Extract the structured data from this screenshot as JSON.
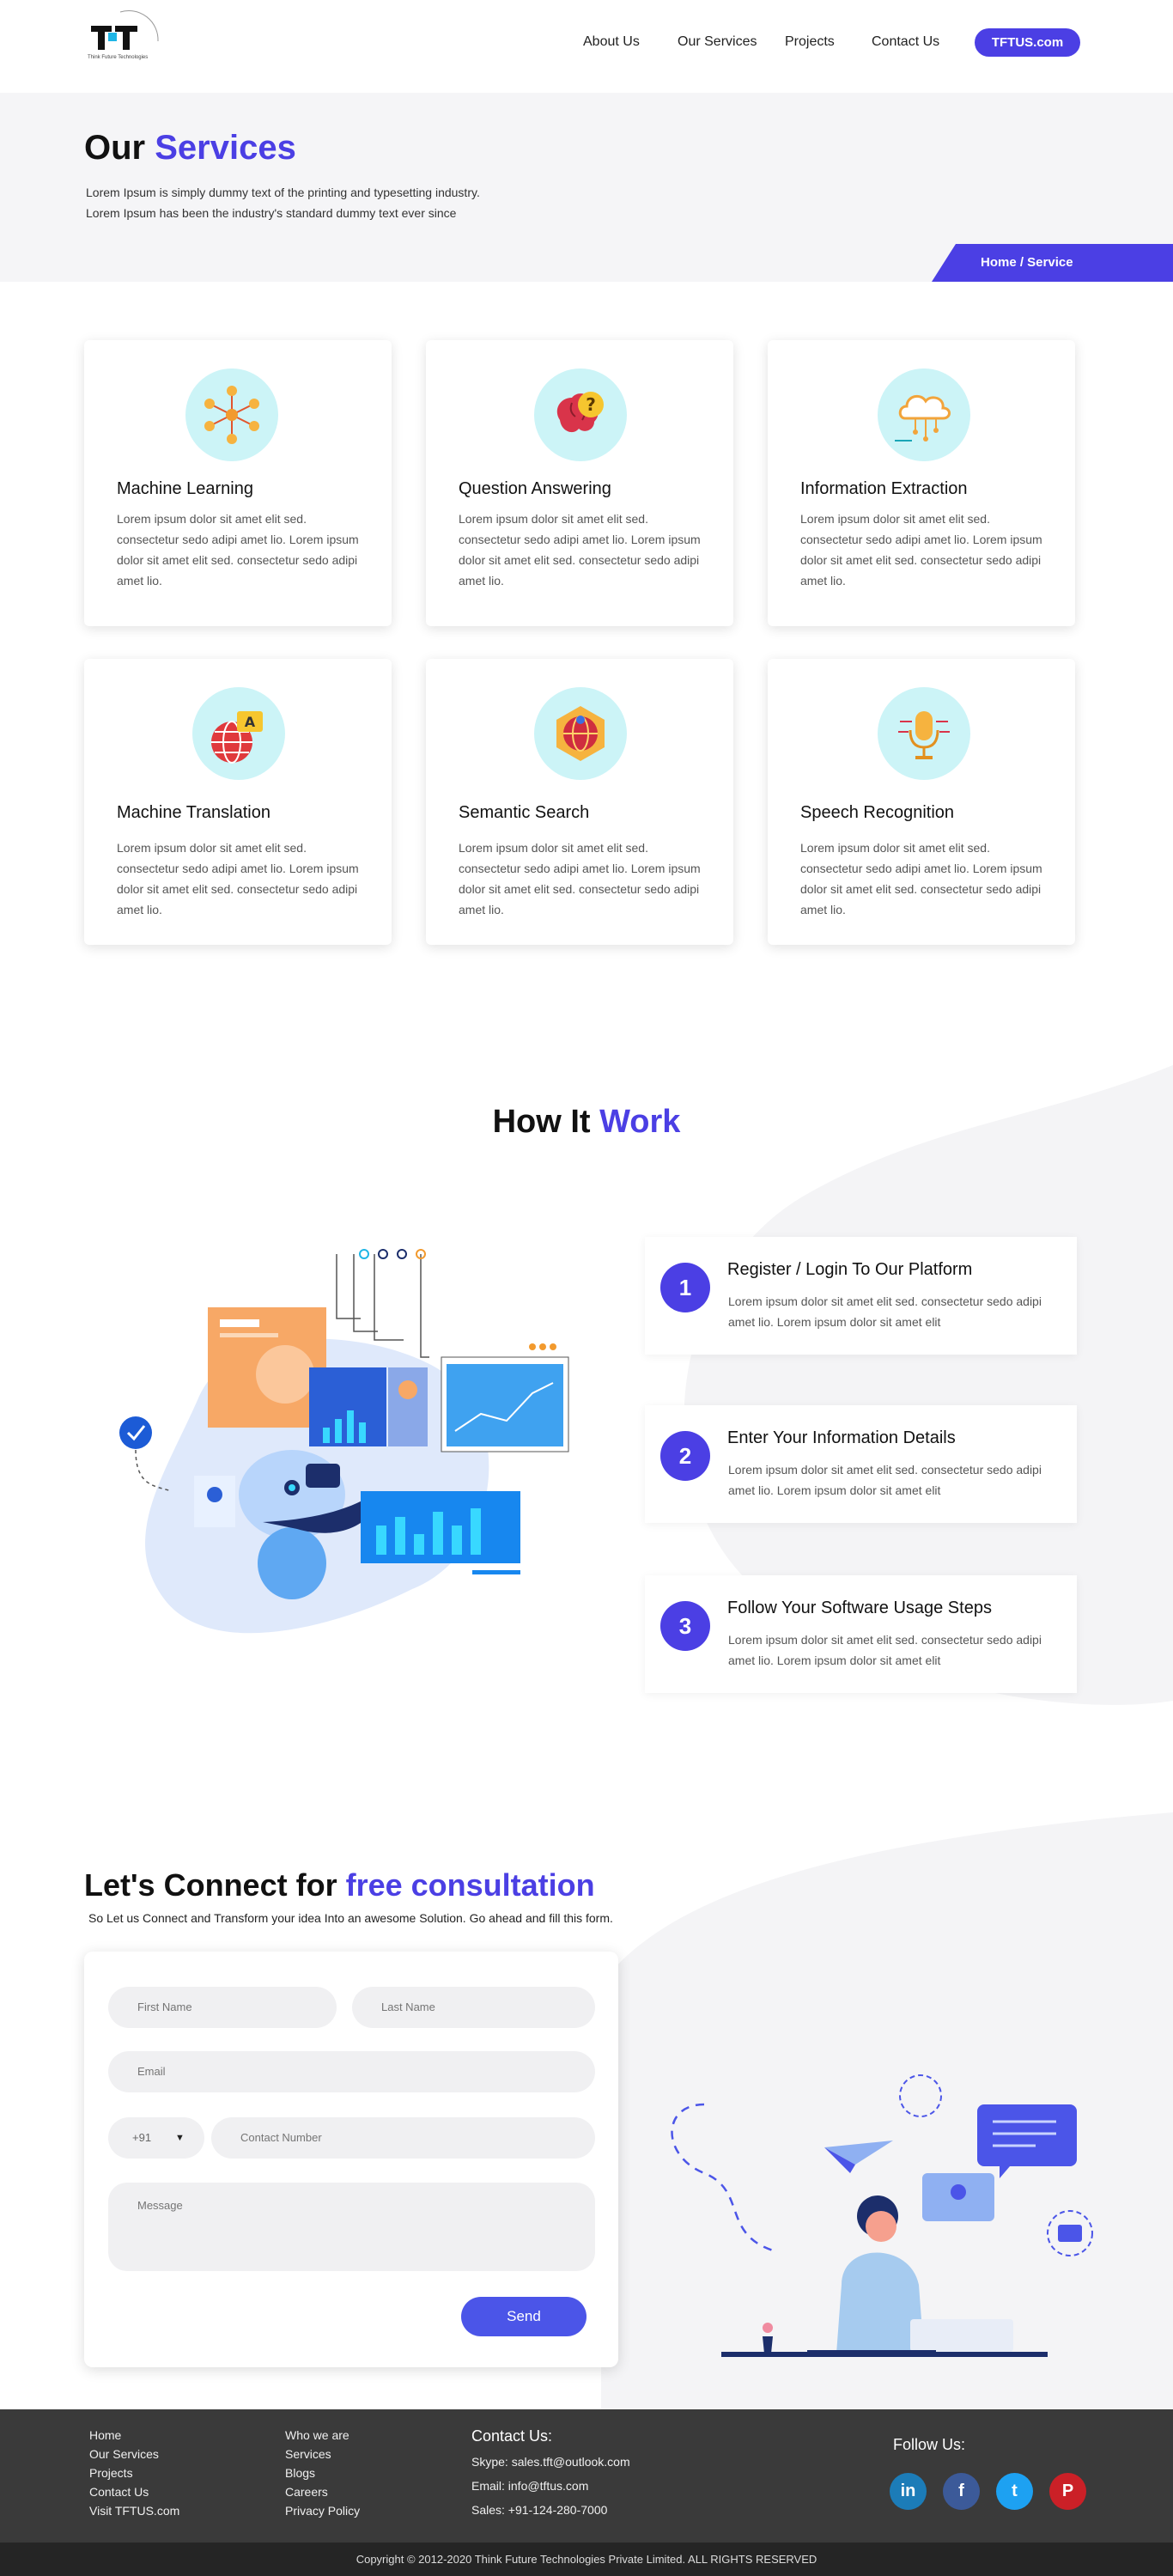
{
  "header": {
    "logo_text": "TFT",
    "logo_tagline": "Think Future Technologies",
    "nav": [
      "About Us",
      "Our Services",
      "Projects",
      "Contact Us"
    ],
    "cta": "TFTUS.com"
  },
  "hero": {
    "title_part1": "Our ",
    "title_part2": "Services",
    "desc_line1": "Lorem Ipsum is simply dummy text of the printing and typesetting industry.",
    "desc_line2": "Lorem Ipsum has been the industry's standard dummy text ever since",
    "breadcrumb": "Home / Service"
  },
  "services": [
    {
      "title": "Machine Learning",
      "icon": "network-icon",
      "desc": "Lorem ipsum dolor sit amet elit sed. consectetur sedo adipi amet lio. Lorem ipsum dolor sit amet elit sed. consectetur sedo adipi amet lio."
    },
    {
      "title": "Question Answering",
      "icon": "brain-question-icon",
      "desc": "Lorem ipsum dolor sit amet elit sed. consectetur sedo adipi amet lio. Lorem ipsum dolor sit amet elit sed. consectetur sedo adipi amet lio."
    },
    {
      "title": "Information Extraction",
      "icon": "cloud-data-icon",
      "desc": "Lorem ipsum dolor sit amet elit sed. consectetur sedo adipi amet lio. Lorem ipsum dolor sit amet elit sed. consectetur sedo adipi amet lio."
    },
    {
      "title": "Machine Translation",
      "icon": "globe-translate-icon",
      "desc": "Lorem ipsum dolor sit amet elit sed. consectetur sedo adipi amet lio. Lorem ipsum dolor sit amet elit sed. consectetur sedo adipi amet lio."
    },
    {
      "title": "Semantic Search",
      "icon": "globe-search-icon",
      "desc": "Lorem ipsum dolor sit amet elit sed. consectetur sedo adipi amet lio. Lorem ipsum dolor sit amet elit sed. consectetur sedo adipi amet lio."
    },
    {
      "title": "Speech Recognition",
      "icon": "microphone-icon",
      "desc": "Lorem ipsum dolor sit amet elit sed. consectetur sedo adipi amet lio. Lorem ipsum dolor sit amet elit sed. consectetur sedo adipi amet lio."
    }
  ],
  "how": {
    "title_part1": "How It ",
    "title_part2": "Work",
    "steps": [
      {
        "num": "1",
        "title": "Register / Login To Our Platform",
        "desc": "Lorem ipsum dolor sit amet elit sed. consectetur sedo adipi amet lio. Lorem ipsum dolor sit amet elit"
      },
      {
        "num": "2",
        "title": "Enter Your Information Details",
        "desc": "Lorem ipsum dolor sit amet elit sed. consectetur sedo adipi amet lio. Lorem ipsum dolor sit amet elit"
      },
      {
        "num": "3",
        "title": "Follow Your Software Usage Steps",
        "desc": "Lorem ipsum dolor sit amet elit sed. consectetur sedo adipi amet lio. Lorem ipsum dolor sit amet elit"
      }
    ]
  },
  "connect": {
    "title_part1": "Let's Connect for ",
    "title_part2": "free consultation",
    "subtitle": "So Let us Connect and Transform your idea Into an awesome Solution. Go ahead and fill this form.",
    "first_name": "First Name",
    "last_name": "Last Name",
    "email": "Email",
    "country_code": "+91",
    "contact_number": "Contact Number",
    "message": "Message",
    "send": "Send"
  },
  "footer": {
    "col1": [
      "Home",
      "Our Services",
      "Projects",
      "Contact Us",
      "Visit TFTUS.com"
    ],
    "col2": [
      "Who we are",
      "Services",
      "Blogs",
      "Careers",
      "Privacy Policy"
    ],
    "contact_title": "Contact Us:",
    "skype": "Skype: sales.tft@outlook.com",
    "email": "Email: info@tftus.com",
    "sales": "Sales: +91-124-280-7000",
    "follow_title": "Follow Us:",
    "social": [
      {
        "label": "in",
        "icon": "linkedin-icon",
        "color": "#1c7cb8"
      },
      {
        "label": "f",
        "icon": "facebook-icon",
        "color": "#3c5a99"
      },
      {
        "label": "t",
        "icon": "twitter-icon",
        "color": "#1da1f2"
      },
      {
        "label": "P",
        "icon": "pinterest-icon",
        "color": "#cb2027"
      }
    ],
    "copyright": "Copyright © 2012-2020 Think Future Technologies Private Limited. ALL RIGHTS RESERVED"
  },
  "colors": {
    "accent": "#4b3fe4",
    "footer_bg": "#3a3a3a",
    "icon_bg": "#ccf4f7"
  }
}
